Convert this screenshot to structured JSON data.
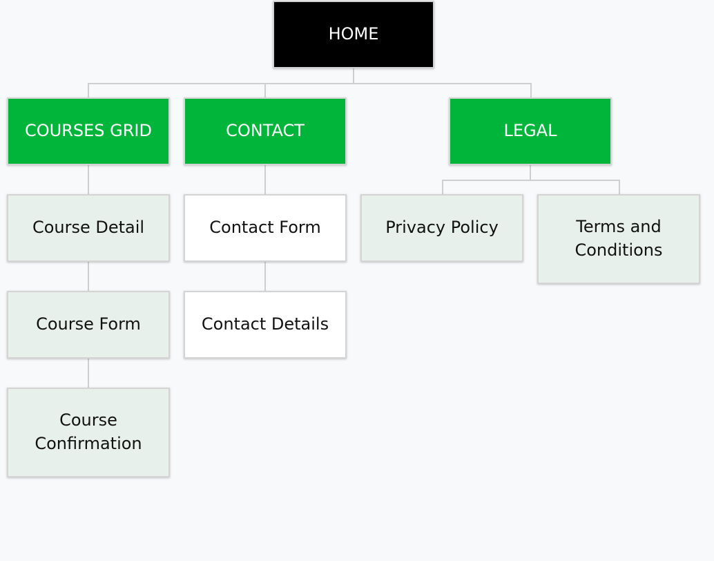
{
  "sitemap": {
    "home": {
      "label": "HOME"
    },
    "sections": {
      "courses_grid": {
        "label": "COURSES GRID",
        "children": {
          "course_detail": {
            "label": "Course Detail"
          },
          "course_form": {
            "label": "Course Form"
          },
          "course_confirmation": {
            "label": "Course\nConfirmation"
          }
        }
      },
      "contact": {
        "label": "CONTACT",
        "children": {
          "contact_form": {
            "label": "Contact Form"
          },
          "contact_details": {
            "label": "Contact Details"
          }
        }
      },
      "legal": {
        "label": "LEGAL",
        "children": {
          "privacy_policy": {
            "label": "Privacy Policy"
          },
          "terms_and_conditions": {
            "label": "Terms and\nConditions"
          }
        }
      }
    }
  },
  "colors": {
    "root": "#000000",
    "section": "#00b53a",
    "subpage": "#e8f0eb",
    "plain_page": "#ffffff",
    "connector": "#cfcfcf",
    "background": "#f7f9fb"
  }
}
